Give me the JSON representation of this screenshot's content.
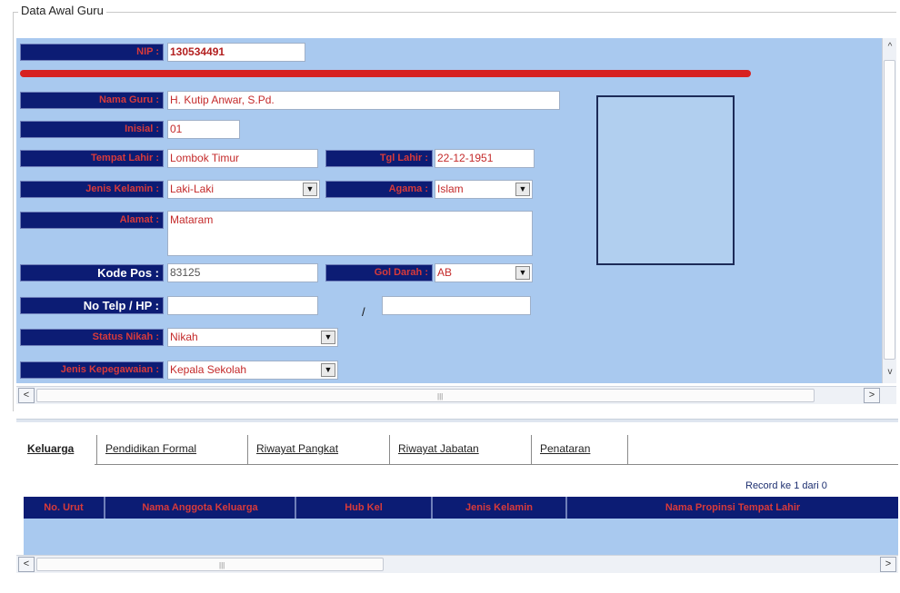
{
  "frame_title": "Data Awal Guru",
  "form": {
    "nip_label": "NIP :",
    "nip_value": "130534491",
    "nama_label": "Nama Guru :",
    "nama_value": "H. Kutip Anwar, S.Pd.",
    "inisial_label": "Inisial :",
    "inisial_value": "01",
    "tempat_lahir_label": "Tempat Lahir :",
    "tempat_lahir_value": "Lombok Timur",
    "tgl_lahir_label": "Tgl Lahir :",
    "tgl_lahir_value": "22-12-1951",
    "jenis_kelamin_label": "Jenis Kelamin :",
    "jenis_kelamin_value": "Laki-Laki",
    "agama_label": "Agama :",
    "agama_value": "Islam",
    "alamat_label": "Alamat :",
    "alamat_value": "Mataram",
    "kode_pos_label": "Kode Pos :",
    "kode_pos_value": "83125",
    "gol_darah_label": "Gol Darah :",
    "gol_darah_value": "AB",
    "no_telp_label": "No Telp / HP :",
    "no_telp_value": "",
    "slash": "/",
    "no_hp_value": "",
    "status_nikah_label": "Status Nikah :",
    "status_nikah_value": "Nikah",
    "jenis_kepegawaian_label": "Jenis Kepegawaian :",
    "jenis_kepegawaian_value": "Kepala Sekolah"
  },
  "tabs": [
    {
      "label": "Keluarga",
      "active": true
    },
    {
      "label": "Pendidikan Formal",
      "active": false
    },
    {
      "label": "Riwayat Pangkat",
      "active": false
    },
    {
      "label": "Riwayat Jabatan",
      "active": false
    },
    {
      "label": "Penataran",
      "active": false
    }
  ],
  "record_info": "Record ke 1 dari 0",
  "grid": {
    "columns": [
      "No. Urut",
      "Nama Anggota Keluarga",
      "Hub Kel",
      "Jenis Kelamin",
      "Nama Propinsi Tempat Lahir"
    ]
  },
  "icons": {
    "dropdown": "▼",
    "arrow_left": "<",
    "arrow_right": ">",
    "arrow_up": "^",
    "arrow_down": "v"
  },
  "colors": {
    "panel_bg": "#a9c9ef",
    "label_bg": "#0c1c74",
    "label_text": "#d83a3a",
    "accent_bar": "#d72121"
  }
}
